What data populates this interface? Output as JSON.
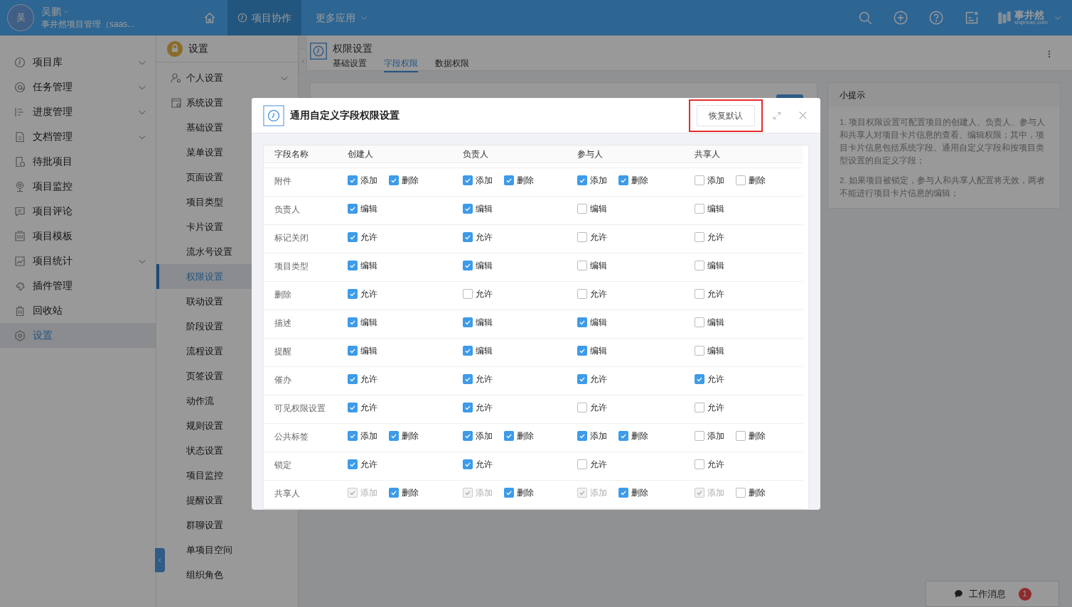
{
  "top_bar": {
    "avatar": "吴",
    "user_name": "吴鹏",
    "org_name": "事井然项目管理（saas...",
    "nav": [
      {
        "kind": "home",
        "selected": false
      },
      {
        "kind": "tab",
        "label": "项目协作",
        "selected": true
      },
      {
        "kind": "menu",
        "label": "更多应用",
        "selected": false
      }
    ],
    "brand": {
      "name": "事井然",
      "domain": "shijinran.com"
    }
  },
  "sidebar": {
    "items": [
      {
        "label": "项目库",
        "expandable": true,
        "selected": false
      },
      {
        "label": "任务管理",
        "expandable": true,
        "selected": false
      },
      {
        "label": "进度管理",
        "expandable": true,
        "selected": false
      },
      {
        "label": "文档管理",
        "expandable": true,
        "selected": false
      },
      {
        "label": "待批项目",
        "expandable": false,
        "selected": false
      },
      {
        "label": "项目监控",
        "expandable": false,
        "selected": false
      },
      {
        "label": "项目评论",
        "expandable": false,
        "selected": false
      },
      {
        "label": "项目模板",
        "expandable": false,
        "selected": false
      },
      {
        "label": "项目统计",
        "expandable": true,
        "selected": false
      },
      {
        "label": "插件管理",
        "expandable": false,
        "selected": false
      },
      {
        "label": "回收站",
        "expandable": false,
        "selected": false
      },
      {
        "label": "设置",
        "expandable": false,
        "selected": true
      }
    ]
  },
  "settings_menu": {
    "title": "设置",
    "groups": [
      {
        "label": "个人设置",
        "expandable": true
      },
      {
        "label": "系统设置",
        "expandable": false,
        "children": [
          {
            "label": "基础设置",
            "selected": false
          },
          {
            "label": "菜单设置",
            "selected": false
          },
          {
            "label": "页面设置",
            "selected": false
          },
          {
            "label": "项目类型",
            "selected": false
          },
          {
            "label": "卡片设置",
            "selected": false
          },
          {
            "label": "流水号设置",
            "selected": false
          },
          {
            "label": "权限设置",
            "selected": true
          },
          {
            "label": "联动设置",
            "selected": false
          },
          {
            "label": "阶段设置",
            "selected": false
          },
          {
            "label": "流程设置",
            "selected": false
          },
          {
            "label": "页签设置",
            "selected": false
          },
          {
            "label": "动作流",
            "selected": false
          },
          {
            "label": "规则设置",
            "selected": false
          },
          {
            "label": "状态设置",
            "selected": false
          },
          {
            "label": "项目监控",
            "selected": false
          },
          {
            "label": "提醒设置",
            "selected": false
          },
          {
            "label": "群聊设置",
            "selected": false
          },
          {
            "label": "单项目空间",
            "selected": false
          },
          {
            "label": "组织角色",
            "selected": false
          }
        ]
      }
    ]
  },
  "page_header": {
    "title": "权限设置",
    "tabs": [
      {
        "label": "基础设置",
        "selected": false
      },
      {
        "label": "字段权限",
        "selected": true
      },
      {
        "label": "数据权限",
        "selected": false
      }
    ]
  },
  "tips": {
    "title": "小提示",
    "paragraphs": [
      "1. 项目权限设置可配置项目的创建人、负责人、参与人和共享人对项目卡片信息的查看、编辑权限；其中，项目卡片信息包括系统字段、通用自定义字段和按项目类型设置的自定义字段；",
      "2. 如果项目被锁定，参与人和共享人配置将无效，两者不能进行项目卡片信息的编辑；"
    ]
  },
  "dialog": {
    "title": "通用自定义字段权限设置",
    "reset_button": "恢复默认",
    "name_header": "字段名称",
    "columns": [
      "创建人",
      "负责人",
      "参与人",
      "共享人"
    ],
    "rows": [
      {
        "name": "附件",
        "cells": [
          [
            {
              "label": "添加",
              "checked": true,
              "disabled": false
            },
            {
              "label": "删除",
              "checked": true,
              "disabled": false
            }
          ],
          [
            {
              "label": "添加",
              "checked": true,
              "disabled": false
            },
            {
              "label": "删除",
              "checked": true,
              "disabled": false
            }
          ],
          [
            {
              "label": "添加",
              "checked": true,
              "disabled": false
            },
            {
              "label": "删除",
              "checked": true,
              "disabled": false
            }
          ],
          [
            {
              "label": "添加",
              "checked": false,
              "disabled": false
            },
            {
              "label": "删除",
              "checked": false,
              "disabled": false
            }
          ]
        ]
      },
      {
        "name": "负责人",
        "cells": [
          [
            {
              "label": "编辑",
              "checked": true,
              "disabled": false
            }
          ],
          [
            {
              "label": "编辑",
              "checked": true,
              "disabled": false
            }
          ],
          [
            {
              "label": "编辑",
              "checked": false,
              "disabled": false
            }
          ],
          [
            {
              "label": "编辑",
              "checked": false,
              "disabled": false
            }
          ]
        ]
      },
      {
        "name": "标记关闭",
        "cells": [
          [
            {
              "label": "允许",
              "checked": true,
              "disabled": false
            }
          ],
          [
            {
              "label": "允许",
              "checked": true,
              "disabled": false
            }
          ],
          [
            {
              "label": "允许",
              "checked": false,
              "disabled": false
            }
          ],
          [
            {
              "label": "允许",
              "checked": false,
              "disabled": false
            }
          ]
        ]
      },
      {
        "name": "项目类型",
        "cells": [
          [
            {
              "label": "编辑",
              "checked": true,
              "disabled": false
            }
          ],
          [
            {
              "label": "编辑",
              "checked": true,
              "disabled": false
            }
          ],
          [
            {
              "label": "编辑",
              "checked": false,
              "disabled": false
            }
          ],
          [
            {
              "label": "编辑",
              "checked": false,
              "disabled": false
            }
          ]
        ]
      },
      {
        "name": "删除",
        "cells": [
          [
            {
              "label": "允许",
              "checked": true,
              "disabled": false
            }
          ],
          [
            {
              "label": "允许",
              "checked": false,
              "disabled": false
            }
          ],
          [
            {
              "label": "允许",
              "checked": false,
              "disabled": false
            }
          ],
          [
            {
              "label": "允许",
              "checked": false,
              "disabled": false
            }
          ]
        ]
      },
      {
        "name": "描述",
        "cells": [
          [
            {
              "label": "编辑",
              "checked": true,
              "disabled": false
            }
          ],
          [
            {
              "label": "编辑",
              "checked": true,
              "disabled": false
            }
          ],
          [
            {
              "label": "编辑",
              "checked": true,
              "disabled": false
            }
          ],
          [
            {
              "label": "编辑",
              "checked": false,
              "disabled": false
            }
          ]
        ]
      },
      {
        "name": "提醒",
        "cells": [
          [
            {
              "label": "编辑",
              "checked": true,
              "disabled": false
            }
          ],
          [
            {
              "label": "编辑",
              "checked": true,
              "disabled": false
            }
          ],
          [
            {
              "label": "编辑",
              "checked": true,
              "disabled": false
            }
          ],
          [
            {
              "label": "编辑",
              "checked": false,
              "disabled": false
            }
          ]
        ]
      },
      {
        "name": "催办",
        "cells": [
          [
            {
              "label": "允许",
              "checked": true,
              "disabled": false
            }
          ],
          [
            {
              "label": "允许",
              "checked": true,
              "disabled": false
            }
          ],
          [
            {
              "label": "允许",
              "checked": true,
              "disabled": false
            }
          ],
          [
            {
              "label": "允许",
              "checked": true,
              "disabled": false
            }
          ]
        ]
      },
      {
        "name": "可见权限设置",
        "cells": [
          [
            {
              "label": "允许",
              "checked": true,
              "disabled": false
            }
          ],
          [
            {
              "label": "允许",
              "checked": true,
              "disabled": false
            }
          ],
          [
            {
              "label": "允许",
              "checked": false,
              "disabled": false
            }
          ],
          [
            {
              "label": "允许",
              "checked": false,
              "disabled": false
            }
          ]
        ]
      },
      {
        "name": "公共标签",
        "cells": [
          [
            {
              "label": "添加",
              "checked": true,
              "disabled": false
            },
            {
              "label": "删除",
              "checked": true,
              "disabled": false
            }
          ],
          [
            {
              "label": "添加",
              "checked": true,
              "disabled": false
            },
            {
              "label": "删除",
              "checked": true,
              "disabled": false
            }
          ],
          [
            {
              "label": "添加",
              "checked": true,
              "disabled": false
            },
            {
              "label": "删除",
              "checked": true,
              "disabled": false
            }
          ],
          [
            {
              "label": "添加",
              "checked": false,
              "disabled": false
            },
            {
              "label": "删除",
              "checked": false,
              "disabled": false
            }
          ]
        ]
      },
      {
        "name": "锁定",
        "cells": [
          [
            {
              "label": "允许",
              "checked": true,
              "disabled": false
            }
          ],
          [
            {
              "label": "允许",
              "checked": true,
              "disabled": false
            }
          ],
          [
            {
              "label": "允许",
              "checked": false,
              "disabled": false
            }
          ],
          [
            {
              "label": "允许",
              "checked": false,
              "disabled": false
            }
          ]
        ]
      },
      {
        "name": "共享人",
        "cells": [
          [
            {
              "label": "添加",
              "checked": true,
              "disabled": true
            },
            {
              "label": "删除",
              "checked": true,
              "disabled": false
            }
          ],
          [
            {
              "label": "添加",
              "checked": true,
              "disabled": true
            },
            {
              "label": "删除",
              "checked": true,
              "disabled": false
            }
          ],
          [
            {
              "label": "添加",
              "checked": true,
              "disabled": true
            },
            {
              "label": "删除",
              "checked": true,
              "disabled": false
            }
          ],
          [
            {
              "label": "添加",
              "checked": true,
              "disabled": true
            },
            {
              "label": "删除",
              "checked": false,
              "disabled": false
            }
          ]
        ]
      }
    ]
  },
  "messages_button": {
    "label": "工作消息",
    "badge": "1"
  }
}
